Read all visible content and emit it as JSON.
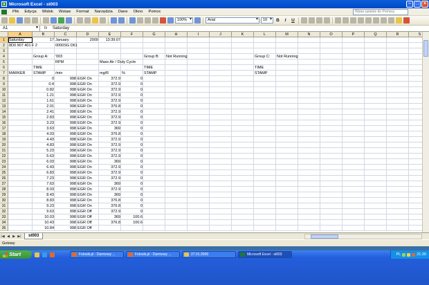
{
  "window": {
    "title": "Microsoft Excel - st003",
    "app_icon": "X"
  },
  "menu": {
    "items": [
      "Plik",
      "Edycja",
      "Widok",
      "Wstaw",
      "Format",
      "Narzędzia",
      "Dane",
      "Okno",
      "Pomoc"
    ],
    "help_placeholder": "Wpisz pytanie do Pomocy"
  },
  "toolbar": {
    "zoom": "100%",
    "font": "Arial",
    "font_size": "10"
  },
  "formula": {
    "name_box": "A1",
    "fx": "fx",
    "value": "Saturday"
  },
  "columns": [
    "A",
    "B",
    "C",
    "D",
    "E",
    "F",
    "G",
    "H",
    "I",
    "J",
    "K",
    "L",
    "M",
    "N",
    "O",
    "P",
    "Q",
    "R",
    "S"
  ],
  "row_numbers": [
    "1",
    "2",
    "3",
    "4",
    "5",
    "6",
    "7",
    "8",
    "9",
    "10",
    "11",
    "12",
    "13",
    "14",
    "15",
    "16",
    "17",
    "18",
    "19",
    "20",
    "21",
    "22",
    "23",
    "24",
    "25",
    "26",
    "27",
    "28",
    "29",
    "30",
    "31",
    "32",
    "33",
    "34",
    "35"
  ],
  "header_cells": {
    "a1": "Saturday",
    "b1": "17",
    "c1": "January",
    "d1": "2009",
    "e1": "13:39:07",
    "a2": "8D0 907 401 F 2",
    "c2": "0000SG  D61",
    "b4": "Group A:",
    "c4": "'003",
    "g4": "Group B:",
    "h4": "Not Running",
    "l4": "Group C:",
    "m4": "Not Running",
    "c5": "RPM",
    "e5": "Mass Air / Duty Cycle",
    "b6": "TIME",
    "g6": "TIME",
    "l6": "TIME",
    "a7": "MARKER",
    "b7": "STAMP",
    "c7": "/min",
    "e7": "mg/R",
    "f7": "%",
    "g7": "STAMP",
    "l7": "STAMP"
  },
  "data_rows": [
    [
      "0",
      "998",
      "EGR On",
      "372.9",
      "0"
    ],
    [
      "0.4",
      "998",
      "EGR On",
      "372.9",
      "0"
    ],
    [
      "0.82",
      "998",
      "EGR On",
      "372.9",
      "0"
    ],
    [
      "1.21",
      "998",
      "EGR On",
      "372.9",
      "0"
    ],
    [
      "1.61",
      "998",
      "EGR On",
      "372.9",
      "0"
    ],
    [
      "2.01",
      "998",
      "EGR On",
      "376.8",
      "0"
    ],
    [
      "2.41",
      "998",
      "EGR On",
      "372.9",
      "0"
    ],
    [
      "2.83",
      "998",
      "EGR On",
      "372.9",
      "0"
    ],
    [
      "3.23",
      "998",
      "EGR On",
      "372.9",
      "0"
    ],
    [
      "3.63",
      "998",
      "EGR On",
      "369",
      "0"
    ],
    [
      "4.03",
      "998",
      "EGR On",
      "376.8",
      "0"
    ],
    [
      "4.43",
      "998",
      "EGR On",
      "372.9",
      "0"
    ],
    [
      "4.83",
      "998",
      "EGR On",
      "372.9",
      "0"
    ],
    [
      "5.23",
      "998",
      "EGR On",
      "372.9",
      "0"
    ],
    [
      "5.63",
      "998",
      "EGR On",
      "372.9",
      "0"
    ],
    [
      "6.03",
      "998",
      "EGR On",
      "369",
      "0"
    ],
    [
      "6.43",
      "998",
      "EGR On",
      "372.9",
      "0"
    ],
    [
      "6.83",
      "998",
      "EGR On",
      "372.9",
      "0"
    ],
    [
      "7.23",
      "998",
      "EGR On",
      "372.9",
      "0"
    ],
    [
      "7.63",
      "998",
      "EGR On",
      "369",
      "0"
    ],
    [
      "8.03",
      "998",
      "EGR On",
      "372.9",
      "0"
    ],
    [
      "8.43",
      "998",
      "EGR On",
      "369",
      "0"
    ],
    [
      "8.83",
      "998",
      "EGR On",
      "376.8",
      "0"
    ],
    [
      "9.23",
      "998",
      "EGR On",
      "376.8",
      "0"
    ],
    [
      "9.63",
      "998",
      "EGR Off",
      "372.9",
      "0"
    ],
    [
      "10.03",
      "998",
      "EGR Off",
      "369",
      "100.6"
    ],
    [
      "10.43",
      "998",
      "EGR Off",
      "376.8",
      "100.6"
    ],
    [
      "10.84",
      "998",
      "EGR Off",
      "",
      ""
    ]
  ],
  "sheet_tab": "st003",
  "status": "Gotowy",
  "taskbar": {
    "start": "Start",
    "tasks": [
      "Fotosik.pl - Darmowy ...",
      "Fotosik.pl - Darmowy ...",
      "27.01.2009",
      "Microsoft Excel - st003"
    ],
    "lang": "PL",
    "clock": "21:30"
  },
  "colors": {
    "title": "#0a5fd8",
    "selected_header": "#f8d088",
    "excel_green": "#1d7a2f"
  }
}
